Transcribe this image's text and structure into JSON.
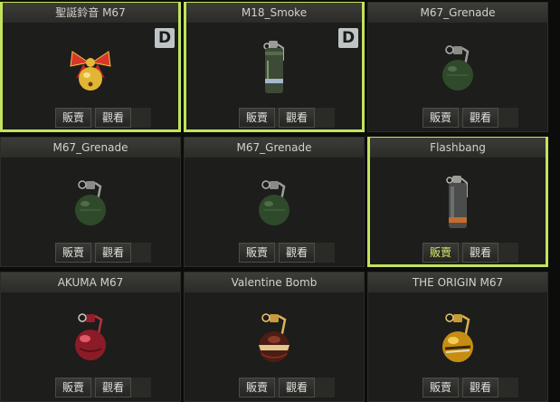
{
  "items": [
    {
      "title": "聖誕鈴音 M67",
      "grade": "D",
      "selected": true,
      "icon": "christmas-bell-grenade",
      "sell_label": "販賣",
      "view_label": "觀看",
      "highlight_sell": false
    },
    {
      "title": "M18_Smoke",
      "grade": "D",
      "selected": true,
      "icon": "smoke-grenade",
      "sell_label": "販賣",
      "view_label": "觀看",
      "highlight_sell": false
    },
    {
      "title": "M67_Grenade",
      "grade": "",
      "selected": false,
      "icon": "frag-grenade",
      "sell_label": "販賣",
      "view_label": "觀看",
      "highlight_sell": false
    },
    {
      "title": "M67_Grenade",
      "grade": "",
      "selected": false,
      "icon": "frag-grenade",
      "sell_label": "販賣",
      "view_label": "觀看",
      "highlight_sell": false
    },
    {
      "title": "M67_Grenade",
      "grade": "",
      "selected": false,
      "icon": "frag-grenade",
      "sell_label": "販賣",
      "view_label": "觀看",
      "highlight_sell": false
    },
    {
      "title": "Flashbang",
      "grade": "",
      "selected": true,
      "icon": "flashbang",
      "sell_label": "販賣",
      "view_label": "觀看",
      "highlight_sell": true
    },
    {
      "title": "AKUMA M67",
      "grade": "",
      "selected": false,
      "icon": "akuma-grenade",
      "sell_label": "販賣",
      "view_label": "觀看",
      "highlight_sell": false
    },
    {
      "title": "Valentine Bomb",
      "grade": "",
      "selected": false,
      "icon": "valentine-bomb",
      "sell_label": "販賣",
      "view_label": "觀看",
      "highlight_sell": false
    },
    {
      "title": "THE ORIGIN M67",
      "grade": "",
      "selected": false,
      "icon": "origin-grenade",
      "sell_label": "販賣",
      "view_label": "觀看",
      "highlight_sell": false
    }
  ],
  "colors": {
    "selected_border": "#c3e35c",
    "panel_bg": "#1d1d1b",
    "title_text": "#d2d2cc",
    "grade_badge_bg": "#bfc4c4"
  }
}
